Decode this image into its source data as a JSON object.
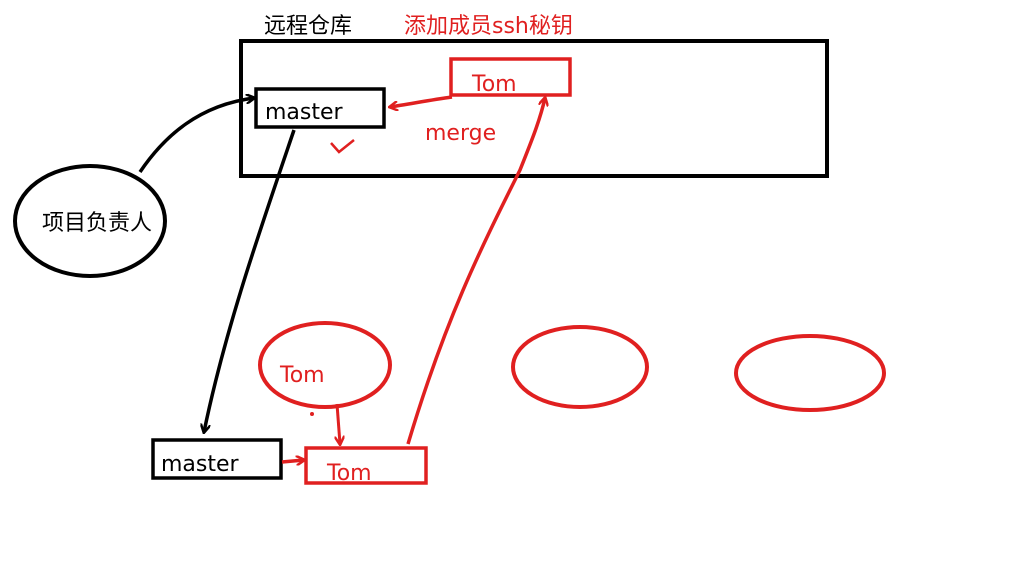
{
  "colors": {
    "ink": "#000000",
    "red": "#e02020",
    "background": "#ffffff"
  },
  "labels": {
    "remote_repo": "远程仓库",
    "add_member_ssh": "添加成员ssh秘钥",
    "remote_master": "master",
    "remote_tom": "Tom",
    "merge": "merge",
    "project_lead": "项目负责人",
    "tom_dev": "Tom",
    "local_master": "master",
    "local_tom": "Tom"
  },
  "marks": {
    "check": "✓",
    "dot": "•"
  }
}
